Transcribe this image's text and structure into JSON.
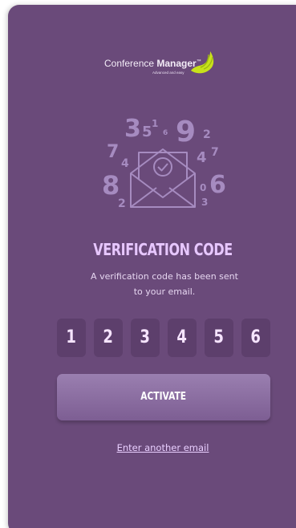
{
  "logo": {
    "name_prefix": "Conference ",
    "name_bold": "Manager",
    "trademark": "™",
    "tagline": "Advanced and easy",
    "mark_color": "#c8e21a"
  },
  "illustration": {
    "icon": "envelope-checkmark-icon",
    "digits": [
      "3",
      "5",
      "1",
      "6",
      "9",
      "2",
      "7",
      "4",
      "4",
      "7",
      "8",
      "2",
      "0",
      "6",
      "3"
    ]
  },
  "verification": {
    "title": "VERIFICATION CODE",
    "message": "A verification code has been sent to your email.",
    "code": [
      "1",
      "2",
      "3",
      "4",
      "5",
      "6"
    ]
  },
  "actions": {
    "activate_label": "ACTIVATE",
    "another_email_label": "Enter another email"
  },
  "colors": {
    "background": "#6a4a7a",
    "accent_text": "#e7c7ff",
    "button": "#8a6da1"
  }
}
